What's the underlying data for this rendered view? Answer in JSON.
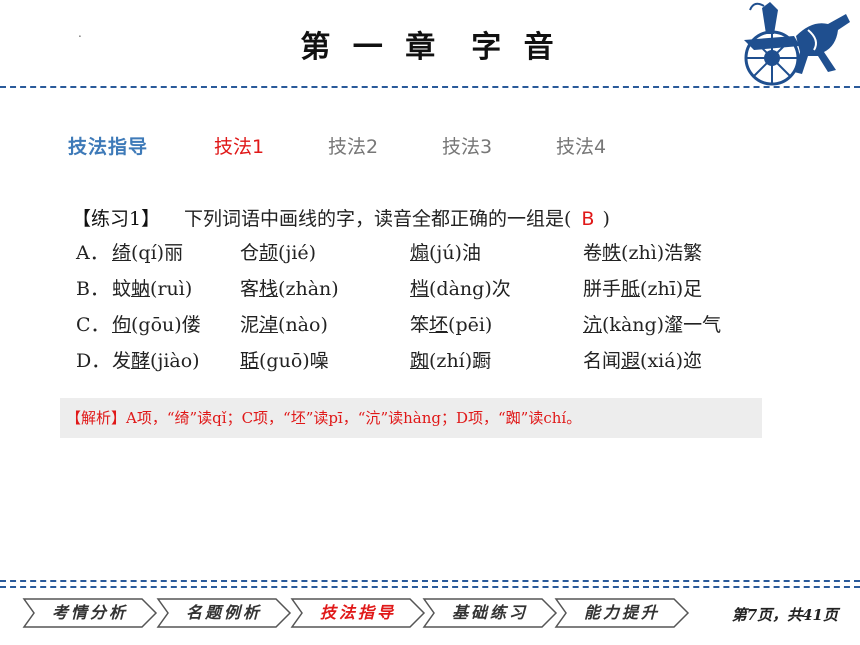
{
  "header": {
    "title_left": "第 一 章",
    "title_right": "字 音",
    "dot": "."
  },
  "nav": {
    "guide_label": "技法指导",
    "items": [
      "技法1",
      "技法2",
      "技法3",
      "技法4"
    ],
    "active_index": 0
  },
  "exercise": {
    "label": "【练习1】",
    "question_prefix": "下列词语中画线的字，读音全都正确的一组是(",
    "answer": "B",
    "question_suffix": ")",
    "options": [
      {
        "letter": "A．",
        "words": [
          {
            "u": "绮",
            "rest": "(qí)丽"
          },
          {
            "pre": "仓",
            "u": "颉",
            "rest": "(jié)"
          },
          {
            "u": "煽",
            "rest": "(jú)油"
          },
          {
            "pre": "卷",
            "u": "帙",
            "rest": "(zhì)浩繁"
          }
        ]
      },
      {
        "letter": "B．",
        "words": [
          {
            "pre": "蚊",
            "u": "蚋",
            "rest": "(ruì)"
          },
          {
            "pre": "客",
            "u": "栈",
            "rest": "(zhàn)"
          },
          {
            "u": "档",
            "rest": "(dàng)次"
          },
          {
            "pre": "胼手",
            "u": "胝",
            "rest": "(zhī)足"
          }
        ]
      },
      {
        "letter": "C．",
        "words": [
          {
            "u": "佝",
            "rest": "(gōu)偻"
          },
          {
            "pre": "泥",
            "u": "淖",
            "rest": "(nào)"
          },
          {
            "pre": "笨",
            "u": "坯",
            "rest": "(pēi)"
          },
          {
            "u": "沆",
            "rest": "(kàng)瀣一气"
          }
        ]
      },
      {
        "letter": "D．",
        "words": [
          {
            "pre": "发",
            "u": "酵",
            "rest": "(jiào)"
          },
          {
            "u": "聒",
            "rest": "(guō)噪"
          },
          {
            "u": "踟",
            "rest": "(zhí)蹰"
          },
          {
            "pre": "名闻",
            "u": "遐",
            "rest": "(xiá)迩"
          }
        ]
      }
    ]
  },
  "analysis": "【解析】A项，“绮”读qǐ；C项，“坯”读pī，“沆”读hàng；D项，“踟”读chí。",
  "footer": {
    "tabs": [
      "考情分析",
      "名题例析",
      "技法指导",
      "基础练习",
      "能力提升"
    ],
    "active_tab": 2,
    "page_info": "第7页，共41页"
  },
  "colors": {
    "accent_blue": "#2a5a9a",
    "highlight_red": "#e01818"
  }
}
